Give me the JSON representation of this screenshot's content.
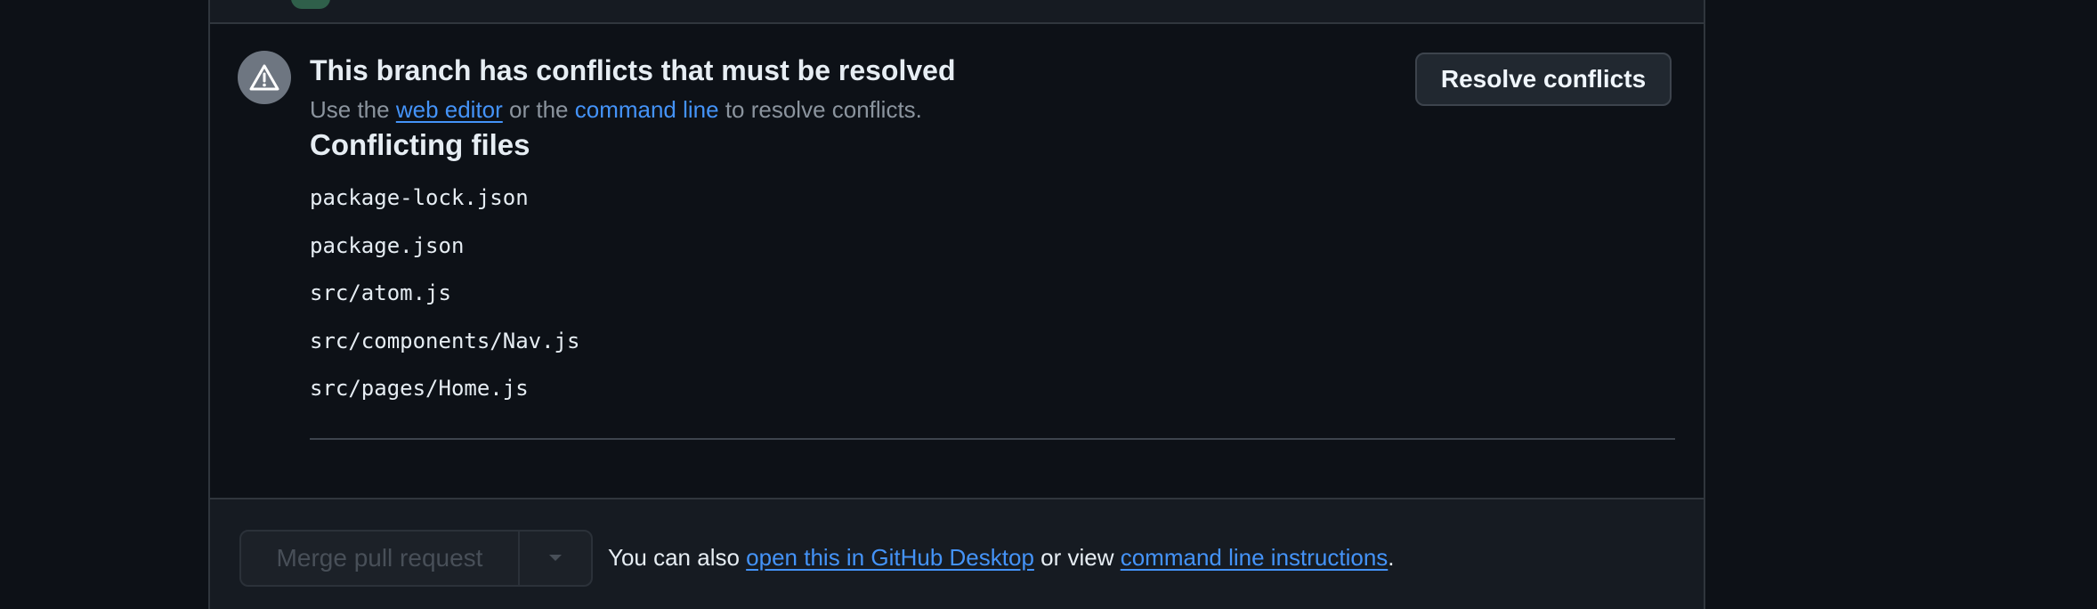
{
  "conflicts": {
    "title": "This branch has conflicts that must be resolved",
    "subtitle": {
      "prefix": "Use the ",
      "web_editor_link": "web editor",
      "middle": " or the ",
      "command_line_link": "command line",
      "suffix": " to resolve conflicts."
    },
    "resolve_button": "Resolve conflicts",
    "files_heading": "Conflicting files",
    "files": [
      "package-lock.json",
      "package.json",
      "src/atom.js",
      "src/components/Nav.js",
      "src/pages/Home.js"
    ],
    "icon": "alert-triangle-icon"
  },
  "merge": {
    "button_label": "Merge pull request",
    "button_disabled": true,
    "dropdown_icon": "caret-down-icon",
    "note": {
      "prefix": "You can also ",
      "desktop_link": "open this in GitHub Desktop",
      "middle": " or view ",
      "instructions_link": "command line instructions",
      "suffix": "."
    }
  },
  "colors": {
    "background": "#0d1117",
    "panel": "#161b22",
    "border": "#30363d",
    "link": "#4493f8",
    "text": "#e6edf3",
    "muted": "#8b949e",
    "warning_circle": "#6e7681"
  }
}
